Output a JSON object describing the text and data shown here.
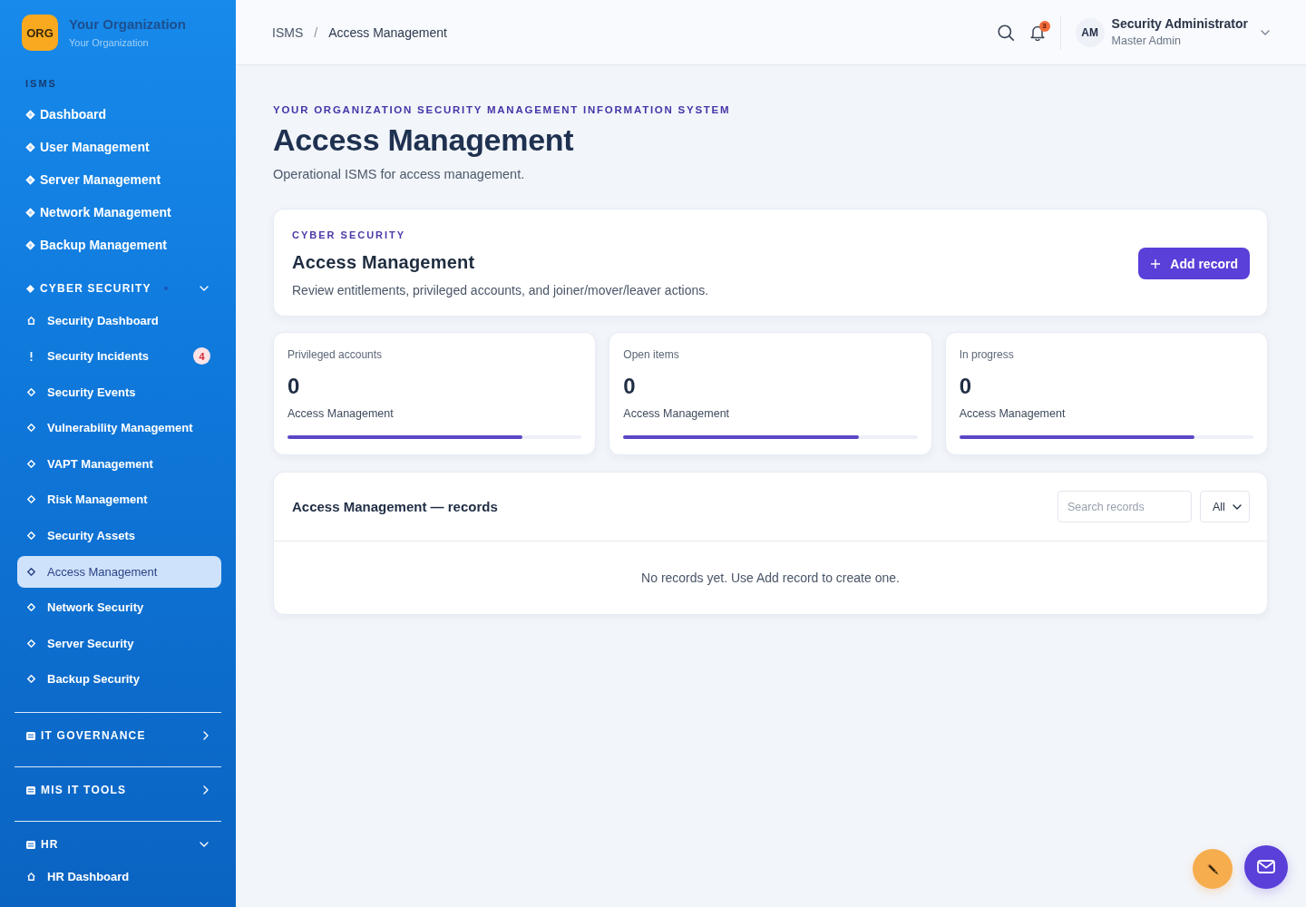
{
  "sidebar": {
    "org": {
      "logo": "ORG",
      "name": "Your Organization",
      "subtitle": "Your Organization"
    },
    "sections": [
      {
        "kind": "list",
        "label": "ISMS",
        "items": [
          {
            "label": "Dashboard",
            "selected": false
          },
          {
            "label": "User Management",
            "selected": false
          },
          {
            "label": "Server Management",
            "selected": false
          },
          {
            "label": "Network Management",
            "selected": false
          },
          {
            "label": "Backup Management",
            "selected": false
          }
        ]
      },
      {
        "kind": "category",
        "label": "CYBER SECURITY",
        "expanded": true,
        "items": [
          {
            "kind": "overview",
            "label": "Security Dashboard",
            "selected": false
          },
          {
            "kind": "alert",
            "label": "Security Incidents",
            "badge": "4",
            "selected": false
          },
          {
            "kind": "module",
            "label": "Security Events",
            "selected": false
          },
          {
            "kind": "module",
            "label": "Vulnerability Management",
            "selected": false
          },
          {
            "kind": "module",
            "label": "VAPT Management",
            "selected": false
          },
          {
            "kind": "module",
            "label": "Risk Management",
            "selected": false
          },
          {
            "kind": "module",
            "label": "Security Assets",
            "selected": false
          },
          {
            "kind": "module",
            "label": "Access Management",
            "selected": true
          },
          {
            "kind": "module",
            "label": "Network Security",
            "selected": false
          },
          {
            "kind": "module",
            "label": "Server Security",
            "selected": false
          },
          {
            "kind": "module",
            "label": "Backup Security",
            "selected": false
          }
        ]
      },
      {
        "kind": "folder",
        "label": "IT GOVERNANCE",
        "expanded": false
      },
      {
        "kind": "folder",
        "label": "MIS IT TOOLS",
        "expanded": false
      },
      {
        "kind": "folder",
        "label": "HR",
        "expanded": true,
        "items": [
          {
            "kind": "overview",
            "label": "HR Dashboard",
            "selected": false
          }
        ]
      }
    ]
  },
  "header": {
    "breadcrumb": [
      "ISMS",
      "Access Management"
    ],
    "separator": "/",
    "notifications": "3",
    "user": {
      "initials": "AM",
      "name": "Security Administrator",
      "role": "Master Admin"
    }
  },
  "page": {
    "eyebrow": "YOUR ORGANIZATION SECURITY MANAGEMENT INFORMATION SYSTEM",
    "title": "Access Management",
    "subtitle": "Operational ISMS for access management."
  },
  "intro_card": {
    "eyebrow": "CYBER SECURITY",
    "title": "Access Management",
    "description": "Review entitlements, privileged accounts, and joiner/mover/leaver actions.",
    "button": "Add record"
  },
  "stats": [
    {
      "label": "Privileged accounts",
      "value": "0",
      "caption": "Access Management",
      "level": 0.8
    },
    {
      "label": "Open items",
      "value": "0",
      "caption": "Access Management",
      "level": 0.8
    },
    {
      "label": "In progress",
      "value": "0",
      "caption": "Access Management",
      "level": 0.8
    }
  ],
  "records": {
    "title": "Access Management — records",
    "search": {
      "placeholder": "Search records"
    },
    "filter": "All",
    "empty": "No records yet. Use Add record to create one."
  }
}
